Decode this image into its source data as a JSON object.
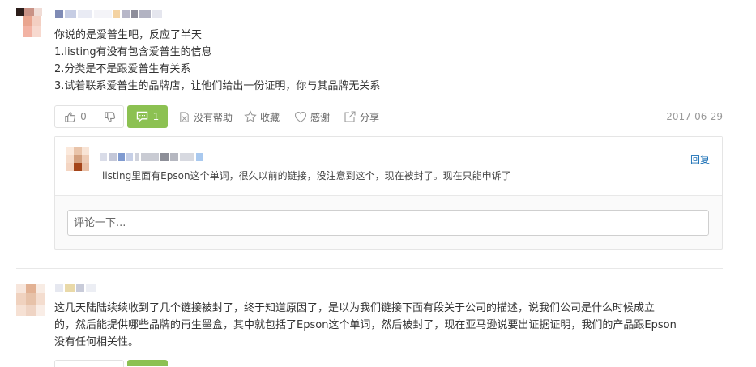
{
  "post1": {
    "lines": [
      "你说的是爱普生吧，反应了半天",
      "1.listing有没有包含爱普生的信息",
      "2.分类是不是跟爱普生有关系",
      "3.试着联系爱普生的品牌店，让他们给出一份证明，你与其品牌无关系"
    ],
    "upvote_count": "0",
    "comment_count": "1",
    "actions": {
      "not_helpful": "没有帮助",
      "favorite": "收藏",
      "thanks": "感谢",
      "share": "分享"
    },
    "date": "2017-06-29",
    "reply": {
      "text": "listing里面有Epson这个单词，很久以前的链接，没注意到这个，现在被封了。现在只能申诉了",
      "reply_label": "回复"
    },
    "comment_placeholder": "评论一下..."
  },
  "post2": {
    "lines": [
      "这几天陆陆续续收到了几个链接被封了，终于知道原因了，是以为我们链接下面有段关于公司的描述，说我们公司是什么时候成立",
      "的，然后能提供哪些品牌的再生墨盒，其中就包括了Epson这个单词，然后被封了，现在亚马逊说要出证据证明，我们的产品跟Epson",
      "没有任何相关性。"
    ]
  },
  "colors": {
    "accent_green": "#8cc152",
    "link_blue": "#1a6fb5",
    "date_gray": "#999999"
  },
  "icons": [
    "thumbs-up-icon",
    "thumbs-down-icon",
    "comment-icon",
    "not-helpful-icon",
    "star-icon",
    "heart-icon",
    "share-icon"
  ]
}
